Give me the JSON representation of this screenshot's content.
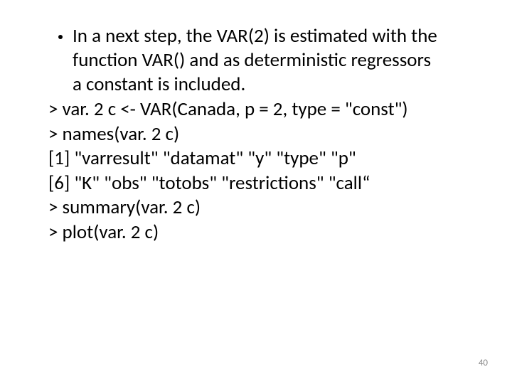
{
  "bullet": {
    "text": "In a next step, the VAR(2) is estimated with the function VAR() and as deterministic regressors a constant is included."
  },
  "lines": {
    "l1": "> var. 2 c <- VAR(Canada, p = 2, type = \"const\")",
    "l2": "> names(var. 2 c)",
    "l3": "[1] \"varresult\" \"datamat\" \"y\" \"type\" \"p\"",
    "l4": "[6] \"K\" \"obs\" \"totobs\" \"restrictions\" \"call“",
    "l5": "> summary(var. 2 c)",
    "l6": "> plot(var. 2 c)"
  },
  "pageNumber": "40"
}
